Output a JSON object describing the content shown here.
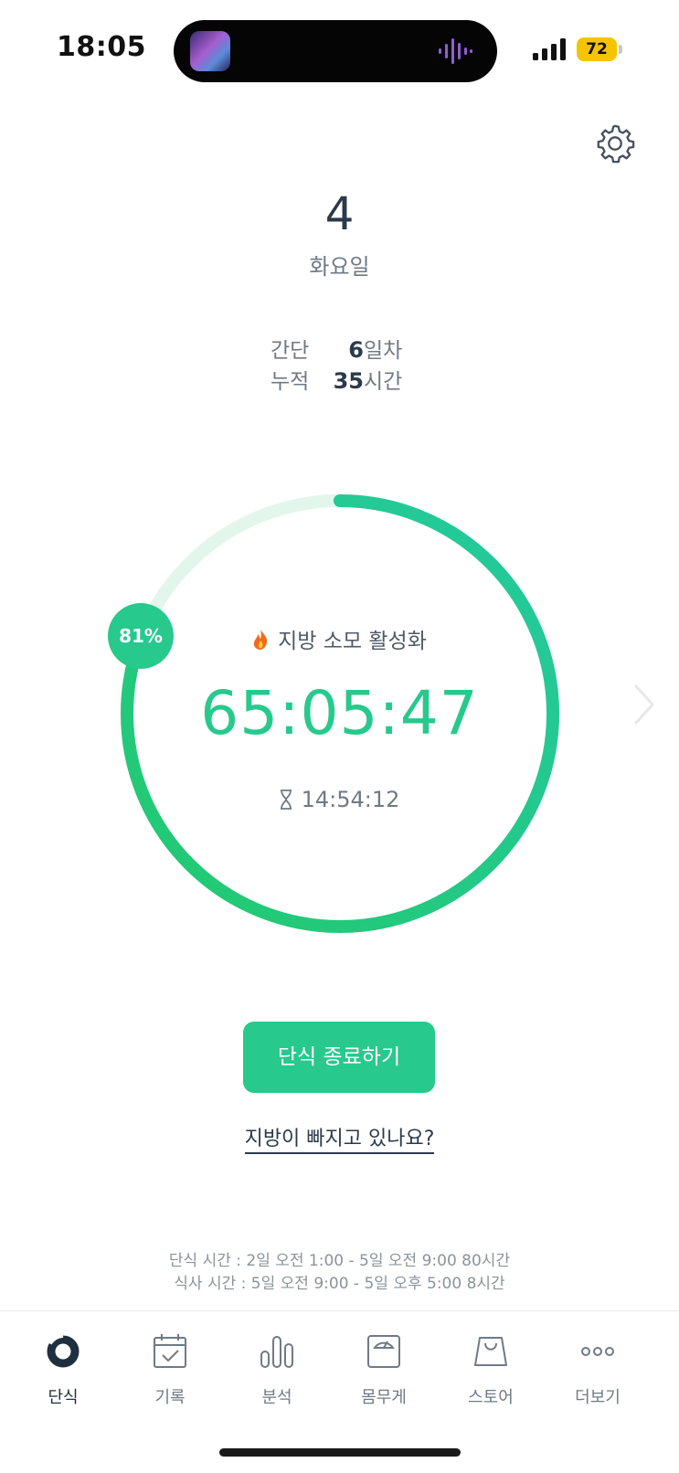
{
  "status_bar": {
    "time": "18:05",
    "battery": "72"
  },
  "header": {
    "day_number": "4",
    "day_name": "화요일"
  },
  "stats": [
    {
      "label": "간단",
      "value": "6",
      "unit": "일차"
    },
    {
      "label": "누적",
      "value": "35",
      "unit": "시간"
    }
  ],
  "timer": {
    "progress_percent_label": "81%",
    "progress": 0.81,
    "phase_label": "지방 소모 활성화",
    "elapsed": "65:05:47",
    "remaining": "14:54:12"
  },
  "actions": {
    "end_button": "단식 종료하기",
    "fat_link": "지방이 빠지고 있나요?"
  },
  "schedule": {
    "fasting": "단식 시간 : 2일 오전 1:00 - 5일 오전 9:00 80시간",
    "eating": "식사 시간 : 5일 오전 9:00 - 5일 오후 5:00 8시간"
  },
  "tabs": [
    {
      "label": "단식",
      "icon": "fasting-ring-icon",
      "active": true
    },
    {
      "label": "기록",
      "icon": "calendar-check-icon"
    },
    {
      "label": "분석",
      "icon": "bar-chart-icon"
    },
    {
      "label": "몸무게",
      "icon": "scale-icon"
    },
    {
      "label": "스토어",
      "icon": "shopping-bag-icon"
    },
    {
      "label": "더보기",
      "icon": "more-dots-icon"
    }
  ],
  "colors": {
    "accent": "#27c98d",
    "accent_light": "#e3f6ec",
    "text_dark": "#2b3a4a"
  }
}
